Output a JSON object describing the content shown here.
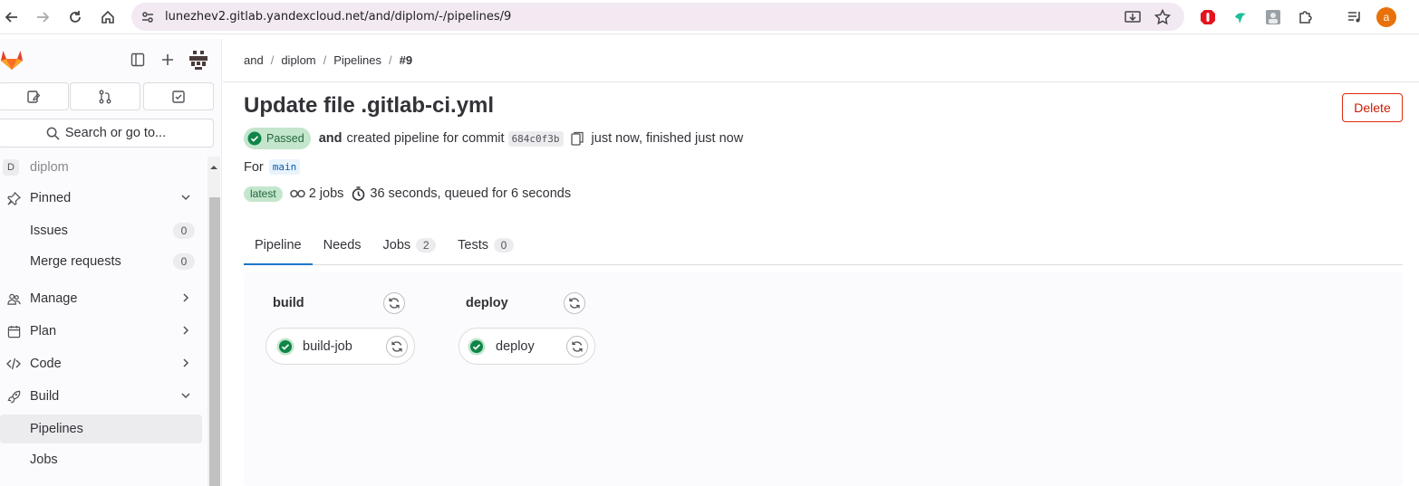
{
  "browser": {
    "url": "lunezhev2.gitlab.yandexcloud.net/and/diplom/-/pipelines/9",
    "profile_initial": "a"
  },
  "sidebar": {
    "project_initial": "D",
    "project_name": "diplom",
    "search_label": "Search or go to...",
    "sections": {
      "pinned": "Pinned",
      "manage": "Manage",
      "plan": "Plan",
      "code": "Code",
      "build": "Build"
    },
    "pinned_items": [
      {
        "label": "Issues",
        "count": "0"
      },
      {
        "label": "Merge requests",
        "count": "0"
      }
    ],
    "build_items": [
      {
        "label": "Pipelines"
      },
      {
        "label": "Jobs"
      }
    ]
  },
  "breadcrumb": [
    "and",
    "diplom",
    "Pipelines",
    "#9"
  ],
  "page": {
    "title": "Update file .gitlab-ci.yml",
    "delete_label": "Delete",
    "status": "Passed",
    "author": "and",
    "created_text": "created pipeline for commit",
    "commit_sha": "684c0f3b",
    "time_text": "just now, finished just now",
    "for_label": "For",
    "ref": "main",
    "latest_label": "latest",
    "jobs_text": "2 jobs",
    "duration_text": "36 seconds, queued for 6 seconds"
  },
  "tabs": [
    {
      "label": "Pipeline",
      "count": null
    },
    {
      "label": "Needs",
      "count": null
    },
    {
      "label": "Jobs",
      "count": "2"
    },
    {
      "label": "Tests",
      "count": "0"
    }
  ],
  "stages": [
    {
      "name": "build",
      "jobs": [
        {
          "name": "build-job",
          "status": "success"
        }
      ]
    },
    {
      "name": "deploy",
      "jobs": [
        {
          "name": "deploy",
          "status": "success"
        }
      ]
    }
  ],
  "colors": {
    "success": "#108548",
    "danger": "#dd2b0e",
    "accent": "#1f75cb"
  }
}
